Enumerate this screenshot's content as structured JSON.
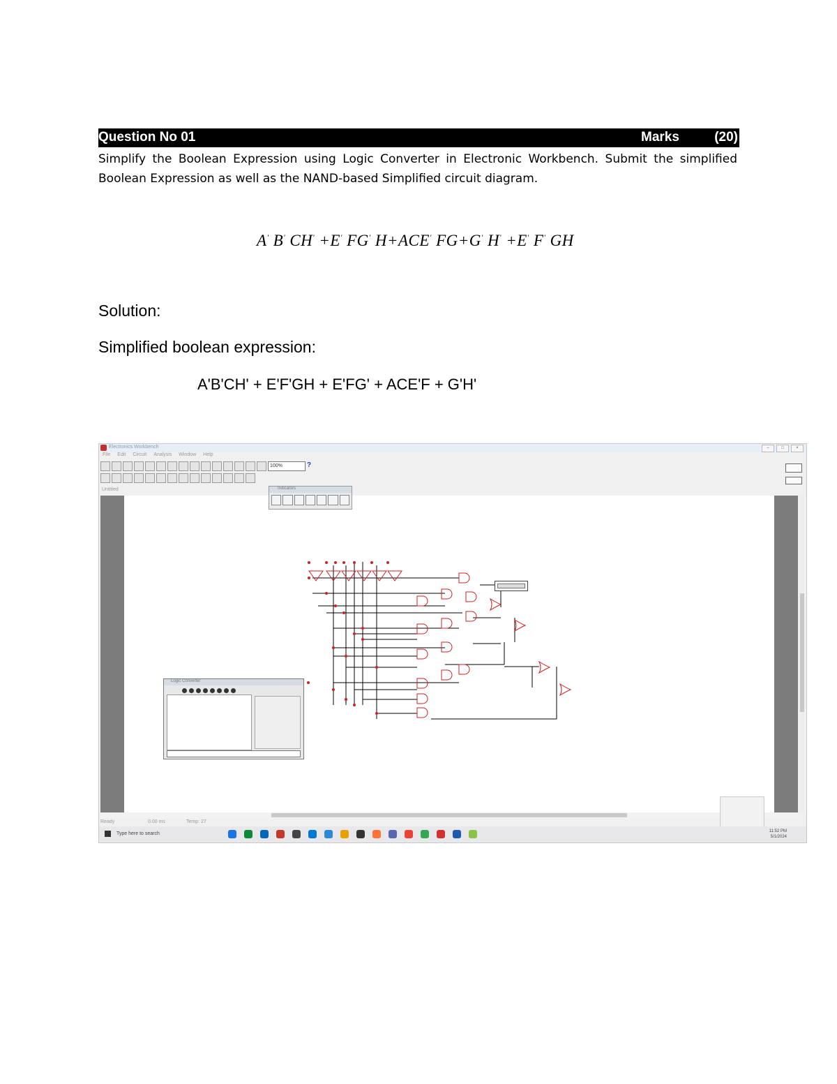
{
  "question": {
    "title": "Question No 01",
    "marks_label": "Marks",
    "marks_value": "(20)"
  },
  "prompt": "Simplify the Boolean Expression using Logic Converter in Electronic Workbench. Submit the simplified Boolean Expression as well as the NAND-based Simplified circuit diagram.",
  "expression": {
    "t1": "A",
    "t2": "B",
    "t3": "CH",
    "t4": "+E",
    "t5": "FG",
    "t6": "H+ACE",
    "t7": "FG+G",
    "t8": "H",
    "t9": "+E",
    "t10": "F",
    "t11": "GH",
    "prime": "'"
  },
  "solution_heading": "Solution:",
  "simplified_heading": "Simplified boolean expression:",
  "answer": "A'B'CH' + E'F'GH + E'FG' + ACE'F + G'H'",
  "screenshot": {
    "app_title": "Electronics Workbench",
    "menu": [
      "File",
      "Edit",
      "Circuit",
      "Analysis",
      "Window",
      "Help"
    ],
    "zoom": "100%",
    "help": "?",
    "doc_tab": "Untitled",
    "minipanel_title": "Indicators",
    "logic_converter_title": "Logic Converter",
    "status": [
      "Ready",
      "0.00 ms",
      "Temp: 27"
    ],
    "taskbar_search": "Type here to search",
    "clock_time": "11:52 PM",
    "clock_date": "5/1/2024",
    "icon_colors": [
      "#1a73e8",
      "#0a8a3a",
      "#0067b8",
      "#c0392b",
      "#444444",
      "#0078d4",
      "#2b88d8",
      "#e6a100",
      "#333333",
      "#ff7139",
      "#5a67b0",
      "#ea4335",
      "#34a853",
      "#d03030",
      "#1e5bb0",
      "#8bc34a"
    ]
  }
}
